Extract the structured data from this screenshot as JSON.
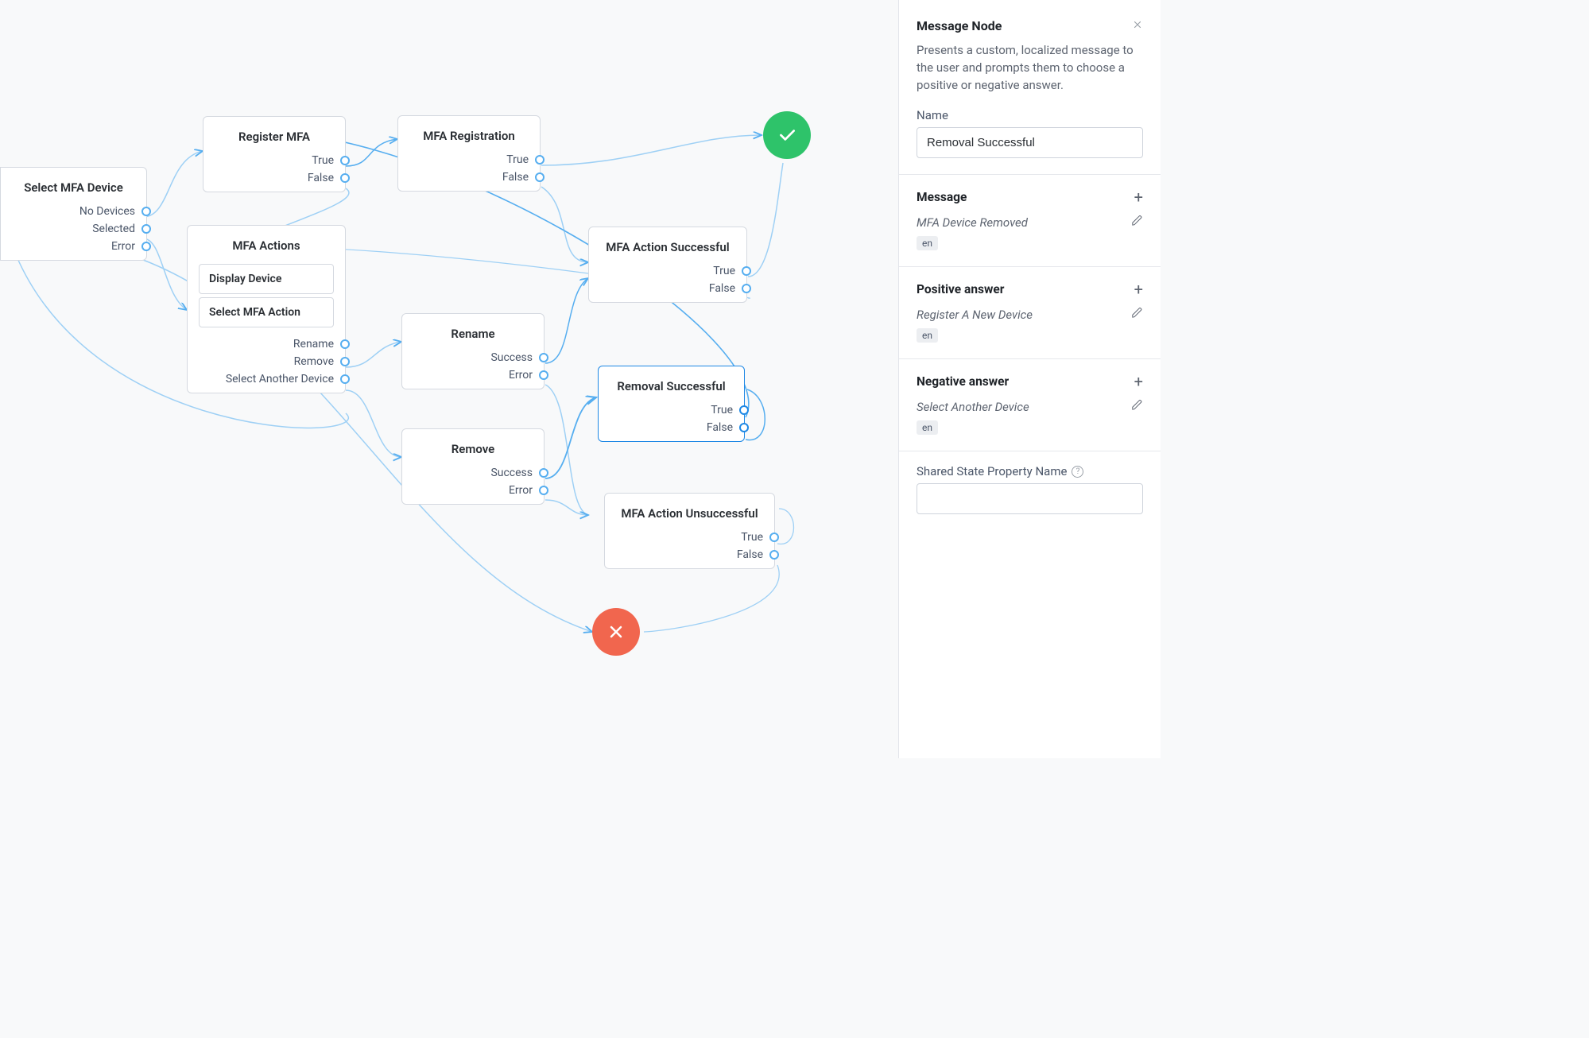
{
  "nodes": {
    "select_mfa_device": {
      "title": "Select MFA Device",
      "outcomes": [
        "No Devices",
        "Selected",
        "Error"
      ]
    },
    "register_mfa": {
      "title": "Register MFA",
      "outcomes": [
        "True",
        "False"
      ]
    },
    "mfa_registration": {
      "title": "MFA Registration",
      "outcomes": [
        "True",
        "False"
      ]
    },
    "mfa_actions": {
      "title": "MFA Actions",
      "inner": [
        "Display Device",
        "Select MFA Action"
      ],
      "outcomes": [
        "Rename",
        "Remove",
        "Select Another Device"
      ]
    },
    "rename": {
      "title": "Rename",
      "outcomes": [
        "Success",
        "Error"
      ]
    },
    "remove": {
      "title": "Remove",
      "outcomes": [
        "Success",
        "Error"
      ]
    },
    "mfa_action_successful": {
      "title": "MFA Action Successful",
      "outcomes": [
        "True",
        "False"
      ]
    },
    "removal_successful": {
      "title": "Removal Successful",
      "outcomes": [
        "True",
        "False"
      ]
    },
    "mfa_action_unsuccessful": {
      "title": "MFA Action Unsuccessful",
      "outcomes": [
        "True",
        "False"
      ]
    }
  },
  "panel": {
    "title": "Message Node",
    "description": "Presents a custom, localized message to the user and prompts them to choose a positive or negative answer.",
    "name_label": "Name",
    "name_value": "Removal Successful",
    "message": {
      "label": "Message",
      "value": "MFA Device Removed",
      "lang": "en"
    },
    "positive": {
      "label": "Positive answer",
      "value": "Register A New Device",
      "lang": "en"
    },
    "negative": {
      "label": "Negative answer",
      "value": "Select Another Device",
      "lang": "en"
    },
    "shared_state_label": "Shared State Property Name",
    "shared_state_value": ""
  }
}
